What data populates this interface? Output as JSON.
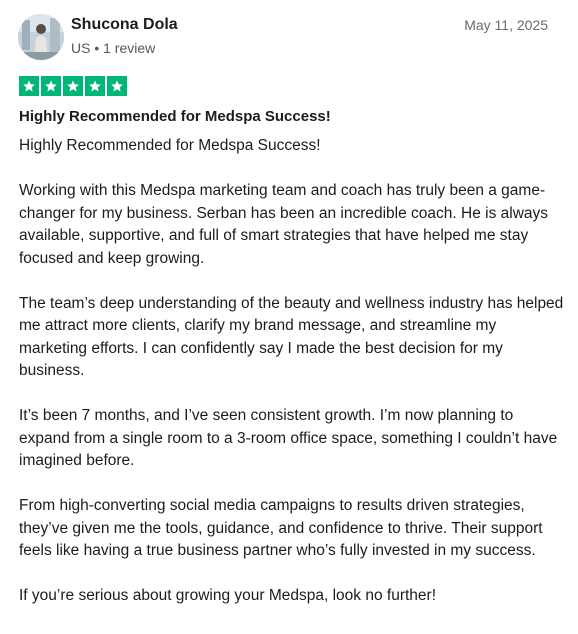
{
  "reviewer": {
    "name": "Shucona Dola",
    "meta": "US • 1 review"
  },
  "review": {
    "date": "May 11, 2025",
    "rating": 5,
    "star_color": "#00b67a",
    "title": "Highly Recommended for Medspa Success!",
    "paragraphs": [
      "Highly Recommended for Medspa Success!",
      "Working with this Medspa marketing team and coach has truly been a game-changer for my business. Serban has been an incredible coach. He is always available, supportive, and full of smart strategies that have helped me stay focused and keep growing.",
      "The team’s deep understanding of the beauty and wellness industry has helped me attract more clients, clarify my brand message, and streamline my marketing efforts. I can confidently say I made the best decision for my business.",
      "It’s been 7 months, and I’ve seen consistent growth. I’m now planning to expand from a single room to a 3-room office space, something I couldn’t have imagined before.",
      "From high-converting social media campaigns to results driven strategies, they’ve given me the tools, guidance, and confidence to thrive. Their support feels like having a true business partner who’s fully invested in my success.",
      "If you’re serious about growing your Medspa, look no further!"
    ]
  }
}
